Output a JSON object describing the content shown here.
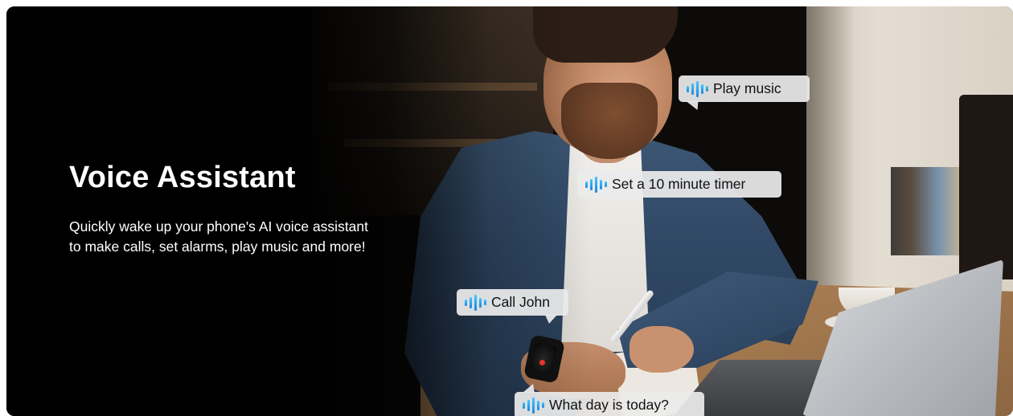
{
  "banner": {
    "title": "Voice Assistant",
    "description": "Quickly wake up your phone's AI voice assistant to make calls, set alarms, play music and more!"
  },
  "bubbles": [
    {
      "text": "Play music",
      "icon": "sound-wave-icon"
    },
    {
      "text": "Set a 10 minute timer",
      "icon": "sound-wave-icon"
    },
    {
      "text": "Call John",
      "icon": "sound-wave-icon"
    },
    {
      "text": "What day is today?",
      "icon": "sound-wave-icon"
    }
  ],
  "colors": {
    "wave_gradient_top": "#43c6ff",
    "wave_gradient_bottom": "#1b86e0",
    "bubble_background": "#ebebeb",
    "text_on_dark": "#ffffff"
  }
}
